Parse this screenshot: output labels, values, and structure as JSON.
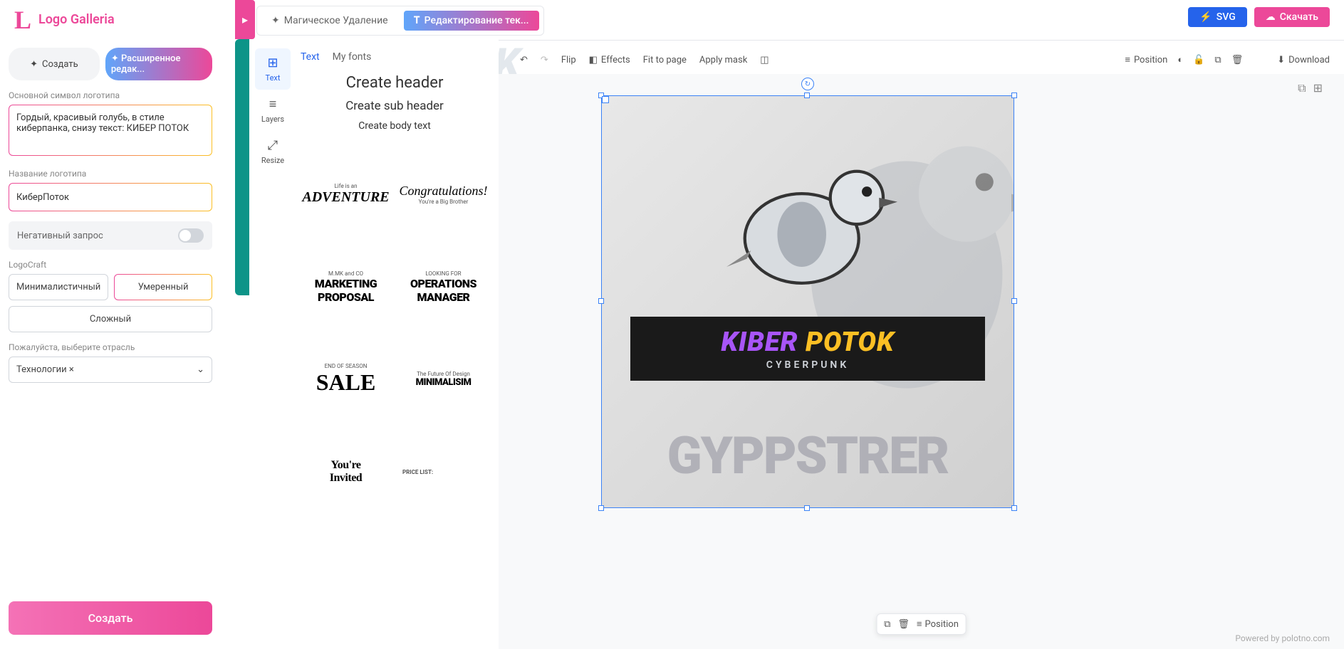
{
  "app_name": "Logo Galleria",
  "top": {
    "magic_remove": "Магическое Удаление",
    "edit_text": "Редактирование тек...",
    "svg": "SVG",
    "download": "Скачать"
  },
  "sidebar": {
    "create": "Создать",
    "advanced": "Расширенное редак...",
    "main_symbol_label": "Основной символ логотипа",
    "main_symbol_value": "Гордый, красивый голубь, в стиле киберпанка, снизу текст: КИБЕР ПОТОК",
    "name_label": "Название логотипа",
    "name_value": "КиберПоток",
    "negative_label": "Негативный запрос",
    "logocraft_label": "LogoCraft",
    "style_min": "Минималистичный",
    "style_mod": "Умеренный",
    "style_complex": "Сложный",
    "industry_label": "Пожалуйста, выберите отрасль",
    "industry_value": "Технологии ×",
    "create_button": "Создать"
  },
  "tools": {
    "text": "Text",
    "layers": "Layers",
    "resize": "Resize"
  },
  "text_panel": {
    "tab_text": "Text",
    "tab_myfonts": "My fonts",
    "create_header": "Create header",
    "create_sub": "Create sub header",
    "create_body": "Create body text",
    "presets": {
      "p1_small": "Life is an",
      "p1_big": "ADVENTURE",
      "p2_script": "Congratulations!",
      "p2_small": "You're a Big Brother",
      "p3_small": "M.MK and CO",
      "p3_l1": "MARKETING",
      "p3_l2": "PROPOSAL",
      "p4_small": "LOOKING FOR",
      "p4_l1": "OPERATIONS",
      "p4_l2": "MANAGER",
      "p5_small": "END OF SEASON",
      "p5_big": "SALE",
      "p6_small": "The Future Of Design",
      "p6_big": "MINIMALISIM",
      "p7_l1": "You're",
      "p7_l2": "Invited",
      "p8_title": "PRICE LIST:"
    }
  },
  "canvas_toolbar": {
    "flip": "Flip",
    "effects": "Effects",
    "fit": "Fit to page",
    "mask": "Apply mask",
    "position": "Position",
    "download": "Download"
  },
  "artwork": {
    "title_p1": "KIBER ",
    "title_p2": "POTOK",
    "subtitle": "CYBERPUNK",
    "bg_text": "GYPPSTRER"
  },
  "float": {
    "position": "Position"
  },
  "ghost": "KIBERPOTOK",
  "powered": "Powered by polotno.com"
}
